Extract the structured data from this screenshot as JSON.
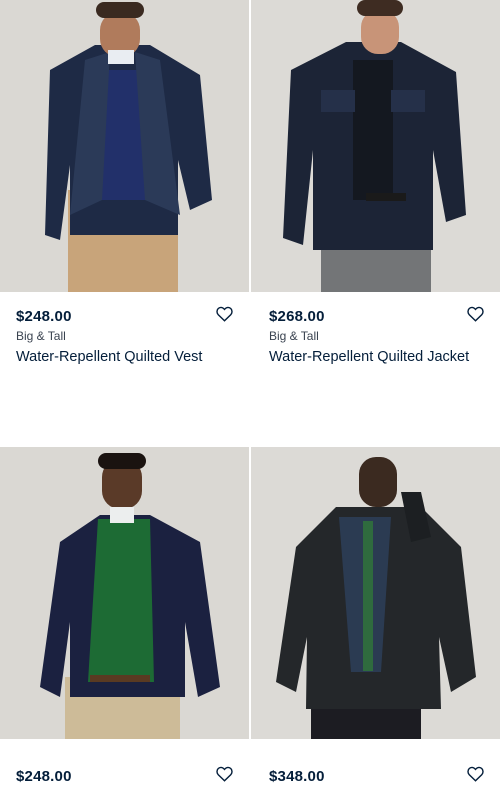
{
  "products": [
    {
      "price": "$248.00",
      "subline": "Big & Tall",
      "name": "Water-Repellent Quilted Vest",
      "wishlist_icon": "heart-outline-icon"
    },
    {
      "price": "$268.00",
      "subline": "Big & Tall",
      "name": "Water-Repellent Quilted Jacket",
      "wishlist_icon": "heart-outline-icon"
    },
    {
      "price": "$248.00",
      "wishlist_icon": "heart-outline-icon"
    },
    {
      "price": "$348.00",
      "wishlist_icon": "heart-outline-icon"
    }
  ],
  "colors": {
    "text": "#041e3a",
    "background": "#ffffff",
    "photo_bg": "#d8d6d1"
  }
}
